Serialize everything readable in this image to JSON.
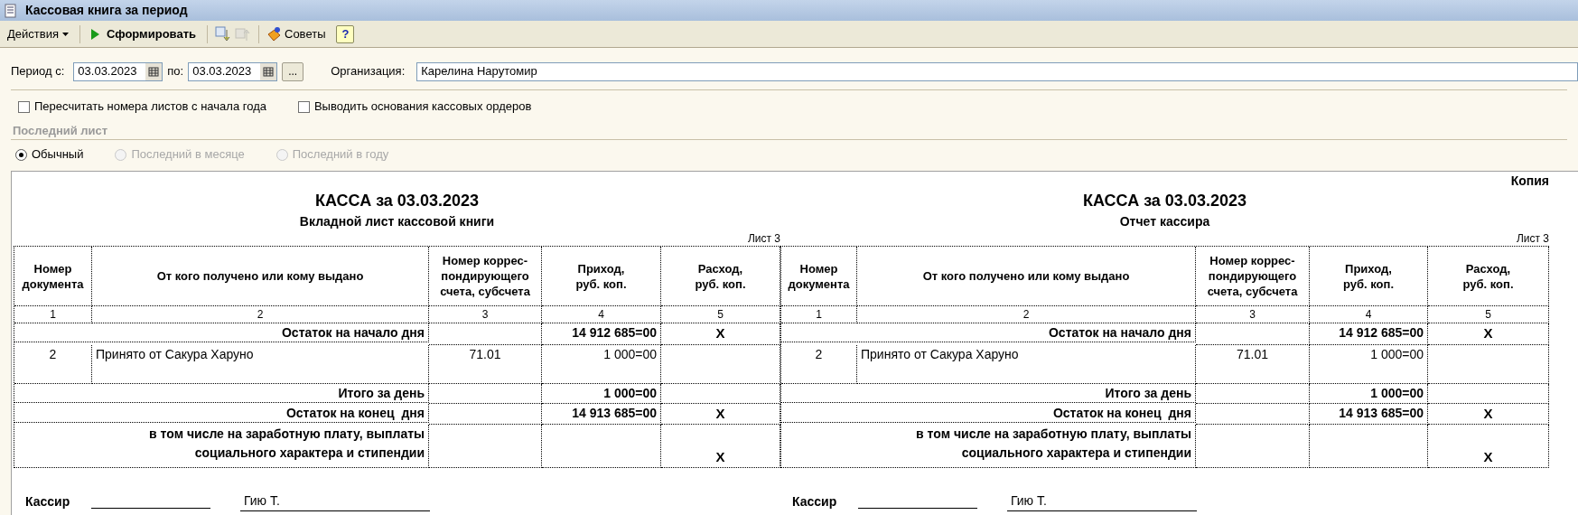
{
  "window": {
    "title": "Кассовая книга за период"
  },
  "toolbar": {
    "actions_menu": "Действия",
    "generate_button": "Сформировать",
    "tips_button": "Советы",
    "help_button": "?"
  },
  "period": {
    "from_label": "Период с:",
    "from_value": "03.03.2023",
    "to_label": "по:",
    "to_value": "03.03.2023",
    "more_button": "...",
    "organization_label": "Организация:",
    "organization_value": "Карелина Нарутомир"
  },
  "options": [
    {
      "label": "Пересчитать номера листов с начала года",
      "checked": false
    },
    {
      "label": "Выводить основания кассовых ордеров",
      "checked": false
    }
  ],
  "last_sheet": {
    "title": "Последний лист",
    "options": [
      {
        "label": "Обычный",
        "selected": true,
        "disabled": false
      },
      {
        "label": "Последний в месяце",
        "selected": false,
        "disabled": true
      },
      {
        "label": "Последний в году",
        "selected": false,
        "disabled": true
      }
    ]
  },
  "report": {
    "pages": [
      {
        "title": "КАССА за 03.03.2023",
        "subtitle": "Вкладной лист кассовой книги",
        "sheet": "Лист 3",
        "columns": [
          "Номер\nдокумента",
          "От кого получено или кому выдано",
          "Номер коррес-\nпондирующего\nсчета, субсчета",
          "Приход,\nруб. коп.",
          "Расход,\nруб. коп."
        ],
        "column_numbers": [
          "1",
          "2",
          "3",
          "4",
          "5"
        ],
        "rows": [
          {
            "kind": "balance",
            "label": "Остаток на начало дня",
            "income": "14 912 685=00",
            "expense": "X"
          },
          {
            "kind": "entry",
            "number": "2",
            "description": "Принято от Сакура Харуно",
            "account": "71.01",
            "income": "1 000=00"
          },
          {
            "kind": "total",
            "label": "Итого за день",
            "income": "1 000=00"
          },
          {
            "kind": "balance",
            "label": "Остаток на конец  дня",
            "income": "14 913 685=00",
            "expense": "X"
          },
          {
            "kind": "salary",
            "label": "в том числе на заработную плату, выплаты\nсоциального характера и стипендии",
            "expense": "X"
          }
        ],
        "signature": {
          "role": "Кассир",
          "name": "Гию Т."
        }
      },
      {
        "copy_label": "Копия",
        "title": "КАССА за 03.03.2023",
        "subtitle": "Отчет кассира",
        "sheet": "Лист 3",
        "columns": [
          "Номер\nдокумента",
          "От кого получено или кому выдано",
          "Номер коррес-\nпондирующего\nсчета, субсчета",
          "Приход,\nруб. коп.",
          "Расход,\nруб. коп."
        ],
        "column_numbers": [
          "1",
          "2",
          "3",
          "4",
          "5"
        ],
        "rows": [
          {
            "kind": "balance",
            "label": "Остаток на начало дня",
            "income": "14 912 685=00",
            "expense": "X"
          },
          {
            "kind": "entry",
            "number": "2",
            "description": "Принято от Сакура Харуно",
            "account": "71.01",
            "income": "1 000=00"
          },
          {
            "kind": "total",
            "label": "Итого за день",
            "income": "1 000=00"
          },
          {
            "kind": "balance",
            "label": "Остаток на конец  дня",
            "income": "14 913 685=00",
            "expense": "X"
          },
          {
            "kind": "salary",
            "label": "в том числе на заработную плату, выплаты\nсоциального характера и стипендии",
            "expense": "X"
          }
        ],
        "signature": {
          "role": "Кассир",
          "name": "Гию Т."
        }
      }
    ]
  }
}
